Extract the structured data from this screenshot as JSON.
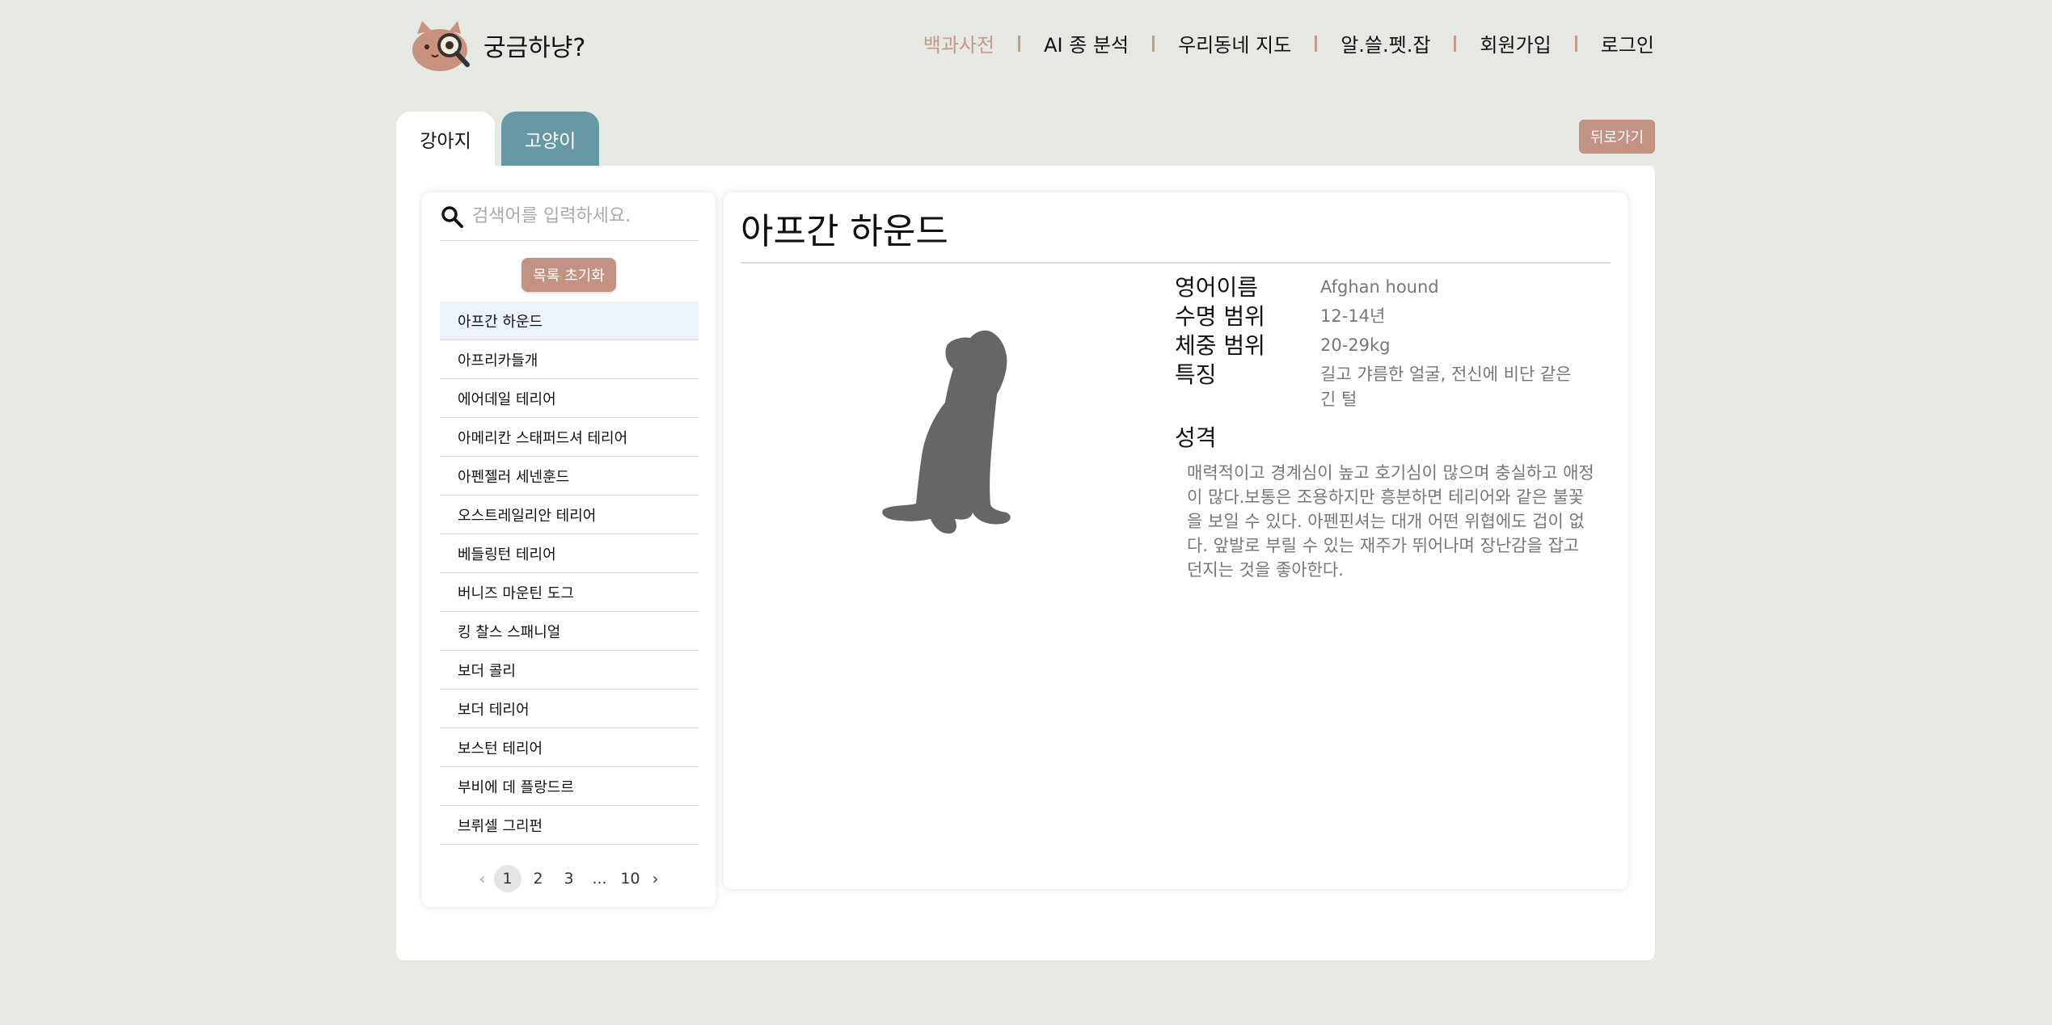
{
  "header": {
    "logo_text": "궁금하냥?",
    "nav": [
      {
        "label": "백과사전",
        "active": true
      },
      {
        "label": "AI 종 분석",
        "active": false
      },
      {
        "label": "우리동네 지도",
        "active": false
      },
      {
        "label": "알.쓸.펫.잡",
        "active": false
      },
      {
        "label": "회원가입",
        "active": false
      },
      {
        "label": "로그인",
        "active": false
      }
    ]
  },
  "tabs": [
    {
      "label": "강아지",
      "active": true
    },
    {
      "label": "고양이",
      "active": false
    }
  ],
  "back_button": "뒤로가기",
  "sidebar": {
    "search_placeholder": "검색어를 입력하세요.",
    "reset_button": "목록 초기화",
    "breeds": [
      "아프간 하운드",
      "아프리카들개",
      "에어데일 테리어",
      "아메리칸 스태퍼드셔 테리어",
      "아펜젤러 세넨훈드",
      "오스트레일리안 테리어",
      "베들링턴 테리어",
      "버니즈 마운틴 도그",
      "킹 찰스 스패니얼",
      "보더 콜리",
      "보더 테리어",
      "보스턴 테리어",
      "부비에 데 플랑드르",
      "브뤼셀 그리펀"
    ],
    "selected_index": 0,
    "pagination": {
      "pages": [
        "1",
        "2",
        "3",
        "...",
        "10"
      ],
      "current": "1"
    }
  },
  "detail": {
    "title": "아프간 하운드",
    "fields": [
      {
        "label": "영어이름",
        "value": "Afghan hound"
      },
      {
        "label": "수명 범위",
        "value": "12-14년"
      },
      {
        "label": "체중 범위",
        "value": "20-29kg"
      },
      {
        "label": "특징",
        "value": "길고 갸름한 얼굴, 전신에 비단 같은 긴 털"
      }
    ],
    "personality_title": "성격",
    "personality_text": "매력적이고 경계심이 높고 호기심이 많으며 충실하고 애정이 많다.보통은 조용하지만 흥분하면 테리어와 같은 불꽃을 보일 수 있다. 아펜핀셔는 대개 어떤 위협에도 겁이 없다. 앞발로 부릴 수 있는 재주가 뛰어나며 장난감을 잡고 던지는 것을 좋아한다."
  },
  "colors": {
    "background": "#e6e8e3",
    "accent": "#c39282",
    "cat_tab": "#6699a3",
    "nav_active": "#c49a8a",
    "silhouette": "#666666"
  }
}
